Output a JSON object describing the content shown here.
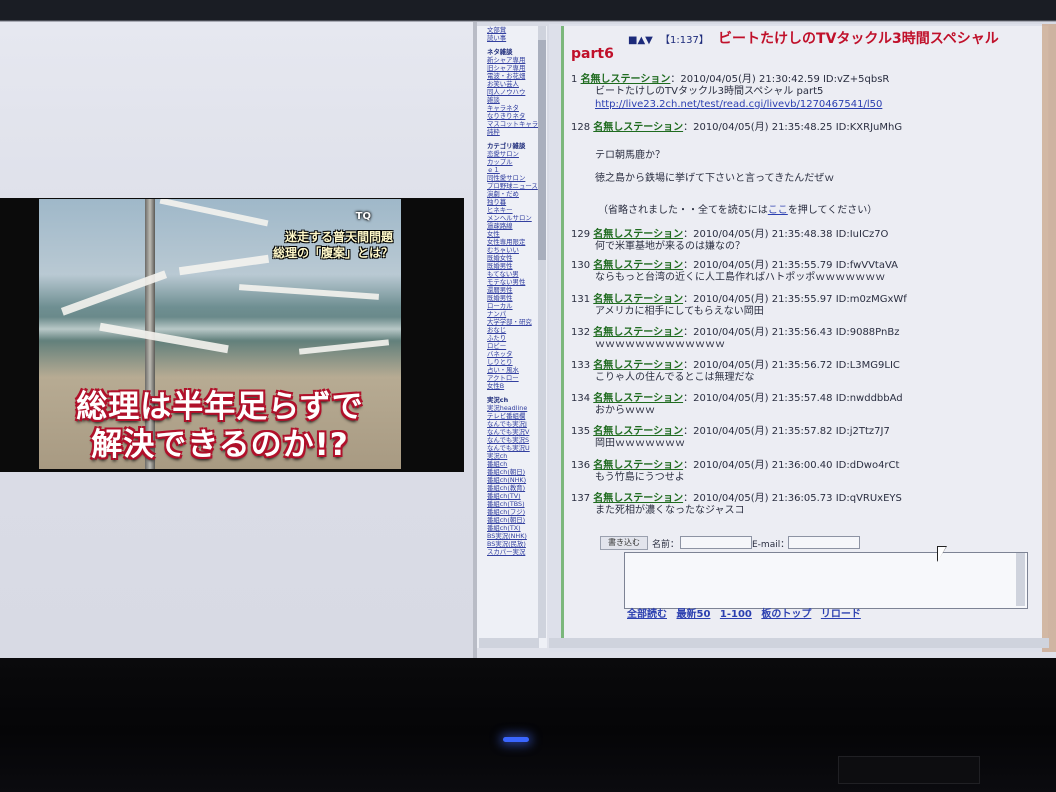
{
  "video": {
    "logo": "TQ",
    "topic_caption_line1": "迷走する普天間問題",
    "topic_caption_line2": "総理の「腹案」とは？",
    "caption_line1": "総理は半年足らずで",
    "caption_line2": "解決できるのか!?"
  },
  "menu": {
    "top": [
      "文部賞",
      "読い事"
    ],
    "categories": [
      {
        "name": "ネタ雑談",
        "items": [
          "新シャア専用",
          "旧シャア専用",
          "電波・お花畑",
          "お笑い芸人",
          "同人ノウハウ",
          "雑談",
          "キャラネタ",
          "なりきりネタ",
          "マスコットキャラ",
          "純粋"
        ]
      },
      {
        "name": "カテゴリ雑談",
        "items": [
          "恋愛サロン",
          "カップル",
          "ｅ１",
          "同性愛サロン",
          "プロ野球ニュース",
          "演劇・だめ",
          "独り暮",
          "ヒネキー",
          "メンヘルサロン",
          "過疎路線",
          "女性",
          "女性専用限定",
          "むちゃいい",
          "既婚女性",
          "既婚男性",
          "もてない男",
          "モテない男性",
          "還暦男性",
          "既婚男性",
          "ローカル",
          "ナンパ",
          "大学学部・研究",
          "おなじ",
          "ふたり",
          "ロビー",
          "バネッタ",
          "しりとり",
          "占い・風水",
          "アクトロー",
          "女性B"
        ]
      },
      {
        "name": "実況ch",
        "items": [
          "実況headline",
          "テレビ番組欄",
          "なんでも実況J",
          "なんでも実況V",
          "なんでも実況S",
          "なんでも実況U",
          "実況ch",
          "番組ch",
          "番組ch(朝日)",
          "番組ch(NHK)",
          "番組ch(教育)",
          "番組ch(TV)",
          "番組ch(TBS)",
          "番組ch(フジ)",
          "番組ch(朝日)",
          "番組ch(TX)",
          "BS実況(NHK)",
          "BS実況(民放)",
          "スカパー実況"
        ]
      }
    ]
  },
  "thread": {
    "nav": "■▲▼",
    "count": "【1:137】",
    "title": "ビートたけしのTVタックル3時間スペシャル",
    "title_part": "part6",
    "posts": [
      {
        "num": "1",
        "name": "名無しステーション",
        "meta": "：2010/04/05(月) 21:30:42.59 ID:vZ+5qbsR",
        "body": "ビートたけしのTVタックル3時間スペシャル part5",
        "link": "http://live23.2ch.net/test/read.cgi/livevb/1270467541/l50"
      },
      {
        "num": "128",
        "name": "名無しステーション",
        "meta": "：2010/04/05(月) 21:35:48.25 ID:KXRJuMhG",
        "body": "テロ朝馬鹿か？",
        "body2": "徳之島から鉄場に挙げて下さいと言ってきたんだぜｗ"
      },
      {
        "num": "129",
        "name": "名無しステーション",
        "meta": "：2010/04/05(月) 21:35:48.38 ID:IuICz7O",
        "body": "何で米軍基地が来るのは嫌なの？"
      },
      {
        "num": "130",
        "name": "名無しステーション",
        "meta": "：2010/04/05(月) 21:35:55.79 ID:fwVVtaVA",
        "body": "ならもっと台湾の近くに人工島作ればハトポッポｗｗｗｗｗｗｗ"
      },
      {
        "num": "131",
        "name": "名無しステーション",
        "meta": "：2010/04/05(月) 21:35:55.97 ID:m0zMGxWf",
        "body": "アメリカに相手にしてもらえない岡田"
      },
      {
        "num": "132",
        "name": "名無しステーション",
        "meta": "：2010/04/05(月) 21:35:56.43 ID:9088PnBz",
        "body": "ｗｗｗｗｗｗｗｗｗｗｗｗｗ"
      },
      {
        "num": "133",
        "name": "名無しステーション",
        "meta": "：2010/04/05(月) 21:35:56.72 ID:L3MG9LIC",
        "body": "こりゃ人の住んでるとこは無理だな"
      },
      {
        "num": "134",
        "name": "名無しステーション",
        "meta": "：2010/04/05(月) 21:35:57.48 ID:nwddbbAd",
        "body": "おからｗｗｗ"
      },
      {
        "num": "135",
        "name": "名無しステーション",
        "meta": "：2010/04/05(月) 21:35:57.82 ID:j2Ttz7J7",
        "body": "岡田ｗｗｗｗｗｗｗ"
      },
      {
        "num": "136",
        "name": "名無しステーション",
        "meta": "：2010/04/05(月) 21:36:00.40 ID:dDwo4rCt",
        "body": "もう竹島にうつせよ"
      },
      {
        "num": "137",
        "name": "名無しステーション",
        "meta": "：2010/04/05(月) 21:36:05.73 ID:qVRUxEYS",
        "body": "また死相が濃くなったなジャスコ"
      }
    ],
    "omit_text": "（省略されました・・全てを読むには",
    "omit_link": "ここ",
    "omit_tail": "を押してください）"
  },
  "form": {
    "write_button": "書き込む",
    "name_label": "名前：",
    "email_label": "E-mail："
  },
  "footer": {
    "read_all": "全部読む",
    "latest50": "最新50",
    "range": "1-100",
    "board_top": "板のトップ",
    "reload": "リロード"
  }
}
